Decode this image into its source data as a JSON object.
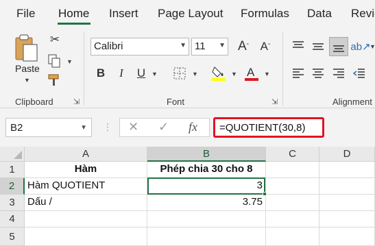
{
  "menu": {
    "tabs": [
      {
        "label": "File"
      },
      {
        "label": "Home"
      },
      {
        "label": "Insert"
      },
      {
        "label": "Page Layout"
      },
      {
        "label": "Formulas"
      },
      {
        "label": "Data"
      },
      {
        "label": "Revie"
      }
    ],
    "active_tab": "Home",
    "accent_color": "#217346"
  },
  "ribbon": {
    "clipboard": {
      "paste_label": "Paste",
      "group_label": "Clipboard",
      "icons": [
        "paste-icon",
        "cut-icon",
        "copy-icon",
        "format-painter-icon"
      ]
    },
    "font": {
      "font_name": "Calibri",
      "font_size": "11",
      "bold": "B",
      "italic": "I",
      "underline": "U",
      "group_label": "Font",
      "icons": [
        "increase-font-icon",
        "decrease-font-icon",
        "borders-icon",
        "fill-color-icon",
        "font-color-icon"
      ],
      "fill_color": "#ffff00",
      "font_color": "#e0151d"
    },
    "alignment": {
      "group_label": "Alignment",
      "icons": [
        "align-top-icon",
        "align-middle-icon",
        "align-bottom-icon",
        "orientation-icon",
        "align-left-icon",
        "align-center-icon",
        "align-right-icon"
      ]
    }
  },
  "formula_bar": {
    "name_box": "B2",
    "formula": "=QUOTIENT(30,8)",
    "icons": [
      "cancel-icon",
      "enter-icon",
      "fx-icon"
    ],
    "highlight_color": "#e0151d"
  },
  "grid": {
    "columns": [
      "A",
      "B",
      "C",
      "D"
    ],
    "rows": [
      "1",
      "2",
      "3",
      "4",
      "5"
    ],
    "selected_cell": "B2",
    "cells": {
      "A1": "Hàm",
      "B1": "Phép chia 30 cho 8",
      "A2": "Hàm QUOTIENT",
      "B2": "3",
      "A3": "Dấu /",
      "B3": "3.75"
    }
  }
}
